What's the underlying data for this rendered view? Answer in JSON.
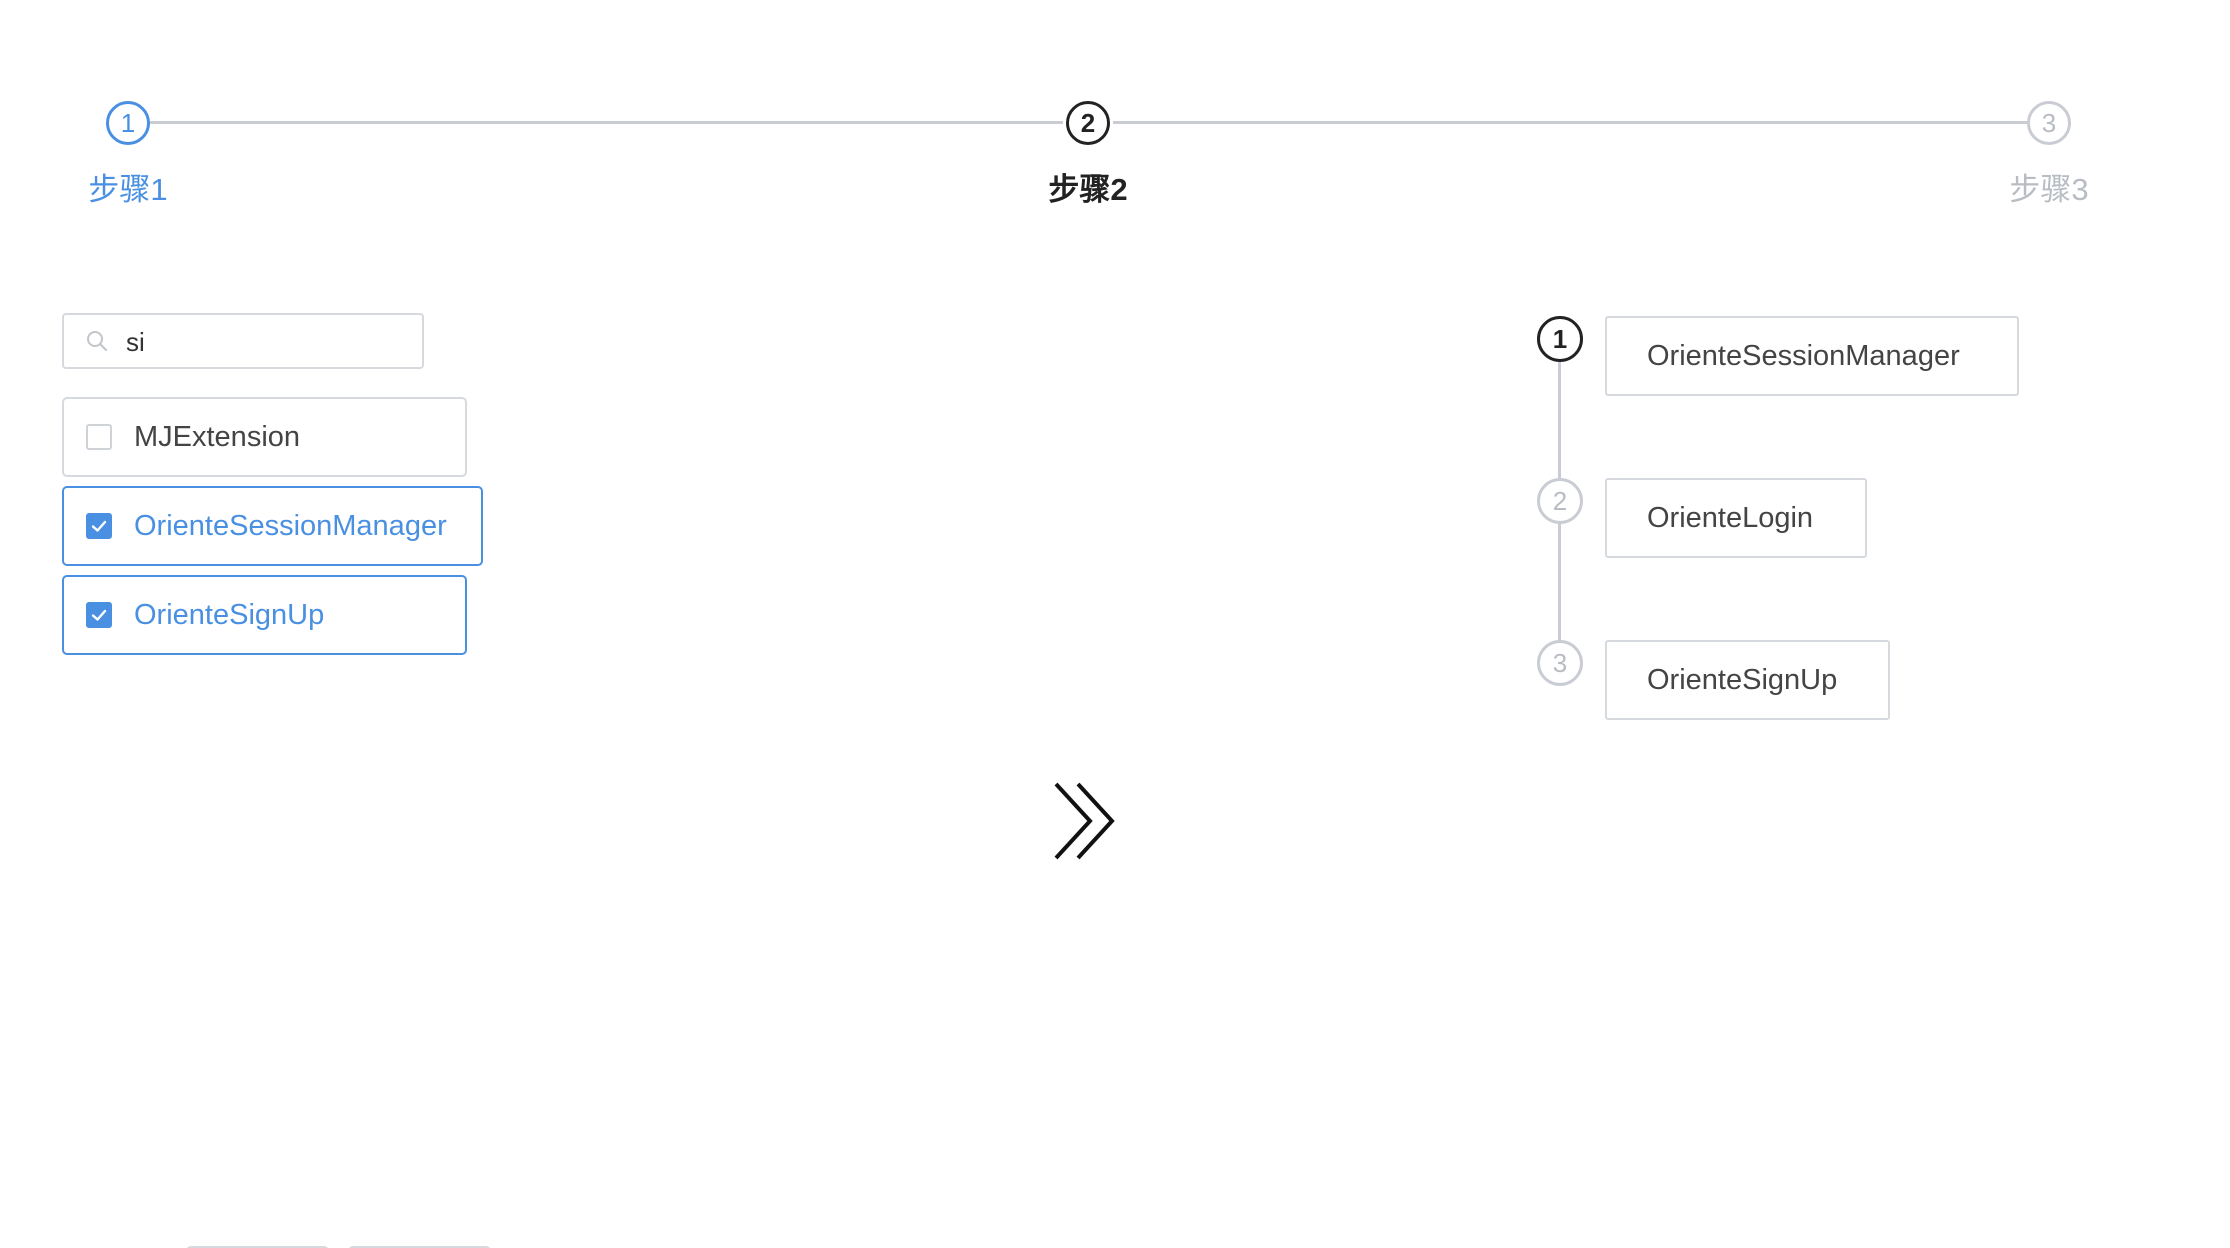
{
  "colors": {
    "accent": "#4a90e2",
    "active": "#222222",
    "inactive": "#b8bcc3",
    "border": "#d6d9de"
  },
  "stepper": {
    "steps": [
      {
        "number": "1",
        "label": "步骤1",
        "status": "done"
      },
      {
        "number": "2",
        "label": "步骤2",
        "status": "active"
      },
      {
        "number": "3",
        "label": "步骤3",
        "status": "wait"
      }
    ]
  },
  "search": {
    "value": "si",
    "icon": "search-icon"
  },
  "list": {
    "items": [
      {
        "label": "MJExtension",
        "checked": false
      },
      {
        "label": "OrienteSessionManager",
        "checked": true
      },
      {
        "label": "OrienteSignUp",
        "checked": true
      }
    ]
  },
  "transfer": {
    "icon": "double-chevron-right-icon"
  },
  "vertical_steps": {
    "items": [
      {
        "number": "1",
        "label": "OrienteSessionManager",
        "status": "active"
      },
      {
        "number": "2",
        "label": "OrienteLogin",
        "status": "wait"
      },
      {
        "number": "3",
        "label": "OrienteSignUp",
        "status": "wait"
      }
    ]
  }
}
